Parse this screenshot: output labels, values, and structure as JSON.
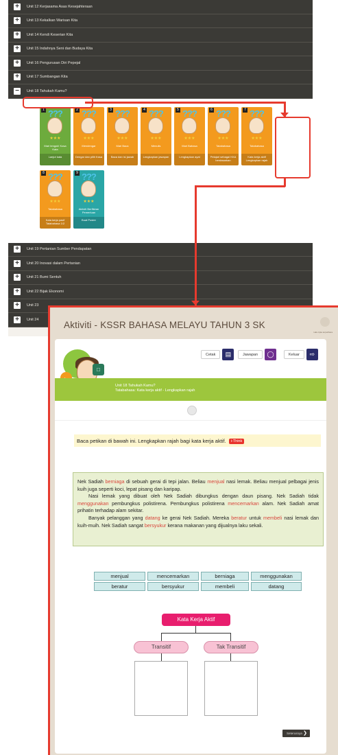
{
  "units_top": [
    "Unit 12 Kerjasama Asas Kesejahteraan",
    "Unit 13 Kekalkan Warisan Kita",
    "Unit 14 Kendi Keserian Kita",
    "Unit 15 Indahnya Seni dan Budaya Kita",
    "Unit 16 Pengurusan Diri Pepejal",
    "Unit 17 Sumbangan Kita",
    "Unit 18 Tahukah Kamu?"
  ],
  "units_bottom": [
    "Unit 19 Pertanian Sumber Pendapatan",
    "Unit 20 Inovasi dalam Pertanian",
    "Unit 21 Bumi Sentuh",
    "Unit 22 Bijak Ekonomi",
    "Unit 23",
    "Unit 24"
  ],
  "cards": [
    {
      "num": "1",
      "label": "Mari tengok! Kosa Kata",
      "sub": "Lanjut kata",
      "color": "#6dab3d"
    },
    {
      "num": "2",
      "label": "Mendengar",
      "sub": "Dengar dan pilih frasa",
      "color": "#f39a1e"
    },
    {
      "num": "3",
      "label": "Mari Baca",
      "sub": "Baca dan isi jawab",
      "color": "#f39a1e"
    },
    {
      "num": "4",
      "label": "Menulis",
      "sub": "Lengkapkan jawapan",
      "color": "#f39a1e"
    },
    {
      "num": "5",
      "label": "Mari Bahasa",
      "sub": "Lengkapkan ayat",
      "color": "#f39a1e"
    },
    {
      "num": "6",
      "label": "Tatabahasa",
      "sub": "Pelajari sebagai KKA berdasarkan",
      "color": "#f39a1e"
    },
    {
      "num": "7",
      "label": "Tatabahasa",
      "sub": "Kata kerja aktif Lengkapkan rajah",
      "color": "#f39a1e"
    },
    {
      "num": "8",
      "label": "Tatabahasa",
      "sub": "Kata kerja pasif Tatabahasa 1/2",
      "color": "#f39a1e"
    },
    {
      "num": "9",
      "label": "Aktiviti Berfikiran Pemerluan",
      "sub": "Buat Poster",
      "color": "#2aa6a6"
    }
  ],
  "activity": {
    "title": "Aktiviti - KSSR BAHASA MELAYU TAHUN 3 SK",
    "tagline": "Hak cipta terpelihara",
    "toolbar": {
      "print": "Cetak",
      "answer": "Jawapan",
      "exit": "Keluar"
    },
    "band_unit": "Unit 18 Tahukah Kamu?",
    "band_path": "Tatabahasa: Kata kerja aktif - Lengkapkan rajah",
    "instruction": "Baca petikan di bawah ini. Lengkapkan rajah bagi kata kerja aktif.",
    "ithink": "i-Think",
    "passage": [
      {
        "t": "Nek Sadiah "
      },
      {
        "t": "berniaga",
        "hl": true
      },
      {
        "t": " di sebuah gerai di tepi jalan. Beliau "
      },
      {
        "t": "menjual",
        "hl": true
      },
      {
        "t": " nasi lemak. Beliau menjual pelbagai jenis kuih juga seperti koci, lepat pisang dan karipap."
      },
      {
        "br": true,
        "indent": true
      },
      {
        "t": "Nasi lemak yang dibuat oleh Nek Sadiah dibungkus dengan daun pisang. Nek Sadiah tidak "
      },
      {
        "t": "menggunakan",
        "hl": true
      },
      {
        "t": " pembungkus polistirena. Pembungkus polistirena "
      },
      {
        "t": "mencemarkan",
        "hl": true
      },
      {
        "t": " alam. Nek Sadiah amat prihatin terhadap alam sekitar."
      },
      {
        "br": true,
        "indent": true
      },
      {
        "t": "Banyak pelanggan yang "
      },
      {
        "t": "datang",
        "hl": true
      },
      {
        "t": " ke gerai Nek Sadiah. Mereka "
      },
      {
        "t": "beratur",
        "hl": true
      },
      {
        "t": " untuk "
      },
      {
        "t": "membeli",
        "hl": true
      },
      {
        "t": " nasi lemak dan kuih-muih. Nek Sadiah sangat "
      },
      {
        "t": "bersyukur",
        "hl": true
      },
      {
        "t": " kerana makanan yang dijualnya laku sekali."
      }
    ],
    "words": [
      [
        "menjual",
        "mencemarkan",
        "berniaga",
        "menggunakan"
      ],
      [
        "beratur",
        "bersyukur",
        "membeli",
        "datang"
      ]
    ],
    "diagram": {
      "root": "Kata Kerja Aktif",
      "left": "Transitif",
      "right": "Tak Transitif"
    },
    "next_label": "Seterusnya"
  },
  "colors": {
    "accent_red": "#e63a2e",
    "unit_bar": "#3b3a36",
    "band_green": "#9dc63d",
    "root_pink": "#e81e6e"
  }
}
